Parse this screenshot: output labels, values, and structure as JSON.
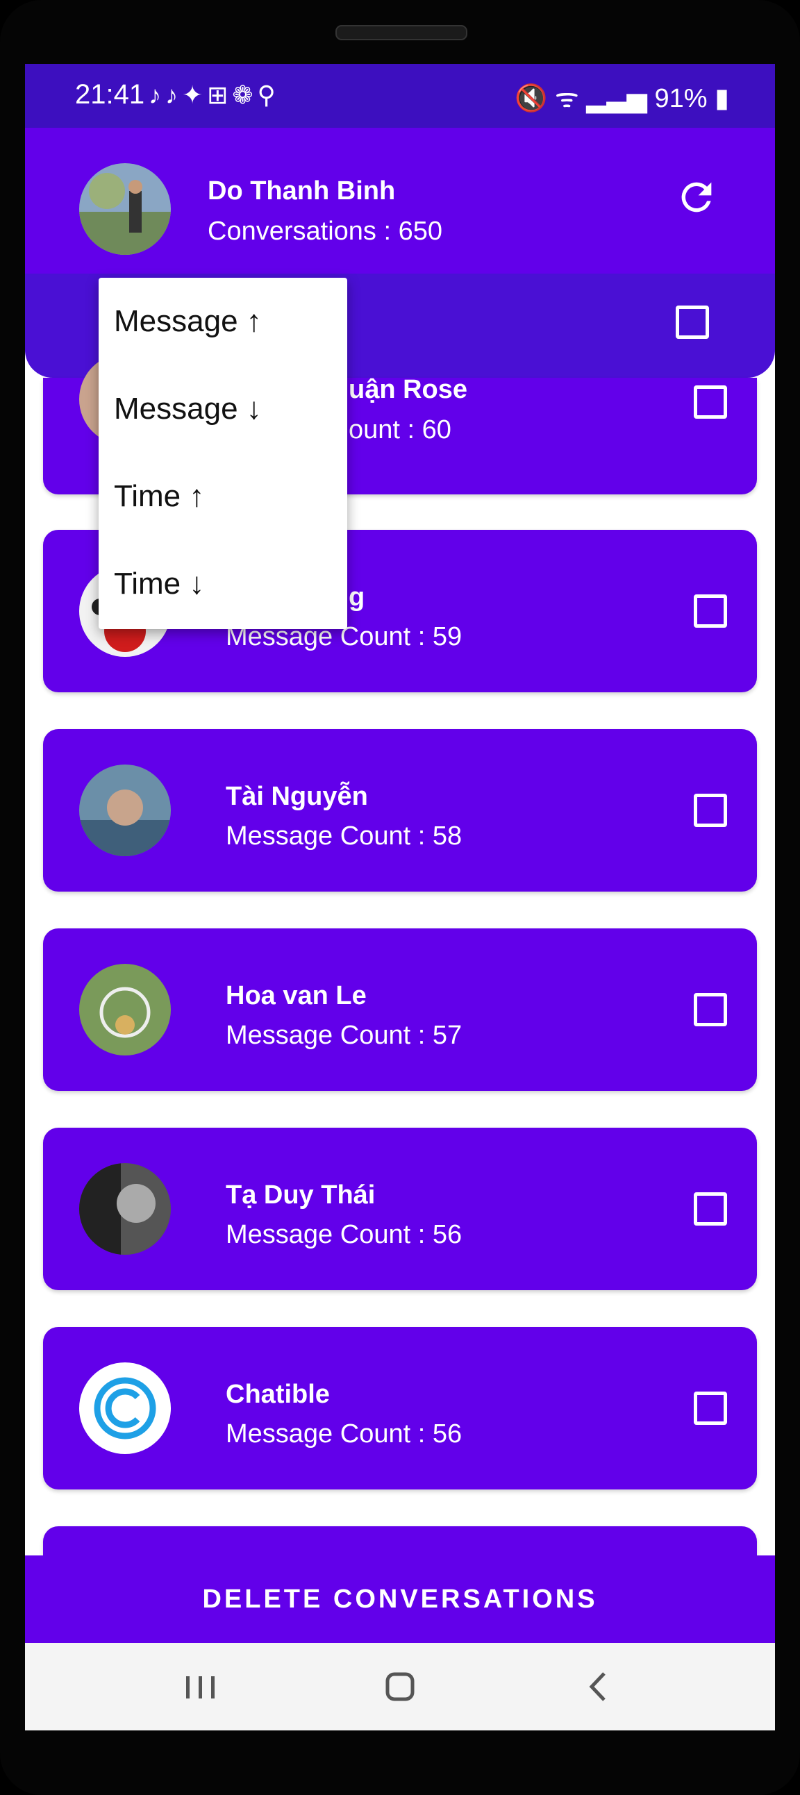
{
  "status_bar": {
    "time": "21:41",
    "left_icons": "♪♪✦⊞❁⚲",
    "right_icons": "🔇 ᯤ ▂▃▅ 91% ▮"
  },
  "header": {
    "user_name": "Do Thanh Binh",
    "conversations_text": "Conversations : 650",
    "refresh_icon": "refresh-icon"
  },
  "sort_menu": {
    "items": [
      "Message ↑",
      "Message ↓",
      "Time ↑",
      "Time ↓"
    ]
  },
  "conversations": [
    {
      "name": "",
      "count_text": ""
    },
    {
      "name": "uận Rose",
      "count_text": "ount : 60"
    },
    {
      "name": "g",
      "count_text": "Message Count : 59"
    },
    {
      "name": "Tài Nguyễn",
      "count_text": "Message Count : 58"
    },
    {
      "name": "Hoa van Le",
      "count_text": "Message Count : 57"
    },
    {
      "name": "Tạ Duy Thái",
      "count_text": "Message Count : 56"
    },
    {
      "name": "Chatible",
      "count_text": "Message Count : 56"
    }
  ],
  "actions": {
    "delete_label": "DELETE CONVERSATIONS"
  },
  "colors": {
    "primary": "#6200ea",
    "status_bar": "#3d0fbf"
  }
}
